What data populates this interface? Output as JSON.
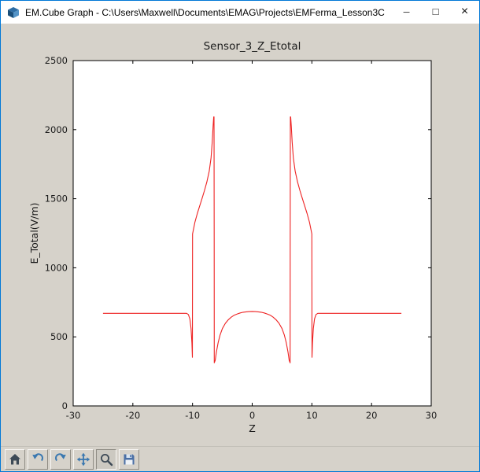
{
  "window": {
    "icon": "emcube-app-icon",
    "title": "EM.Cube Graph - C:\\Users\\Maxwell\\Documents\\EMAG\\Projects\\EMFerma_Lesson3C",
    "controls": {
      "minimize": "─",
      "maximize": "□",
      "close": "×"
    }
  },
  "toolbar": {
    "buttons": [
      {
        "id": "home",
        "icon": "home-icon"
      },
      {
        "id": "back",
        "icon": "back-arrow-icon"
      },
      {
        "id": "forward",
        "icon": "forward-arrow-icon"
      },
      {
        "id": "pan",
        "icon": "pan-arrows-icon"
      },
      {
        "id": "zoom",
        "icon": "zoom-magnifier-icon",
        "active": true
      },
      {
        "id": "save",
        "icon": "save-floppy-icon"
      }
    ]
  },
  "colors": {
    "accent_border": "#0078d7",
    "window_background": "#d6d2ca",
    "plot_background": "#ffffff",
    "axis_color": "#000000",
    "line_color": "#ee2222"
  },
  "chart_data": {
    "type": "line",
    "title": "Sensor_3_Z_Etotal",
    "xlabel": "Z",
    "ylabel": "E_Total(V/m)",
    "xlim": [
      -30,
      30
    ],
    "ylim": [
      0,
      2500
    ],
    "xticks": [
      -30,
      -20,
      -10,
      0,
      10,
      20,
      30
    ],
    "yticks": [
      0,
      500,
      1000,
      1500,
      2000,
      2500
    ],
    "grid": false,
    "line_color": "#ee2222",
    "series": [
      {
        "name": "E_Total",
        "color": "#ee2222",
        "points": [
          [
            -25,
            670
          ],
          [
            -11,
            670
          ],
          [
            -10.7,
            662
          ],
          [
            -10.45,
            630
          ],
          [
            -10.25,
            560
          ],
          [
            -10.1,
            455
          ],
          [
            -10.02,
            352
          ],
          [
            -10,
            1245
          ],
          [
            -9.6,
            1330
          ],
          [
            -9.2,
            1392
          ],
          [
            -8.8,
            1448
          ],
          [
            -8.4,
            1502
          ],
          [
            -8,
            1558
          ],
          [
            -7.6,
            1622
          ],
          [
            -7.2,
            1700
          ],
          [
            -6.9,
            1795
          ],
          [
            -6.7,
            1910
          ],
          [
            -6.55,
            2025
          ],
          [
            -6.45,
            2092
          ],
          [
            -6.4,
            2092
          ],
          [
            -6.37,
            1200
          ],
          [
            -6.35,
            312
          ],
          [
            -6.2,
            330
          ],
          [
            -6,
            390
          ],
          [
            -5.7,
            460
          ],
          [
            -5.4,
            512
          ],
          [
            -5,
            560
          ],
          [
            -4.5,
            598
          ],
          [
            -4,
            624
          ],
          [
            -3.5,
            643
          ],
          [
            -3,
            657
          ],
          [
            -2.5,
            666
          ],
          [
            -2,
            673
          ],
          [
            -1.5,
            678
          ],
          [
            -1,
            681
          ],
          [
            -0.5,
            683
          ],
          [
            0,
            684
          ],
          [
            0.5,
            683
          ],
          [
            1,
            681
          ],
          [
            1.5,
            678
          ],
          [
            2,
            673
          ],
          [
            2.5,
            666
          ],
          [
            3,
            657
          ],
          [
            3.5,
            643
          ],
          [
            4,
            624
          ],
          [
            4.5,
            598
          ],
          [
            5,
            560
          ],
          [
            5.4,
            512
          ],
          [
            5.7,
            460
          ],
          [
            6,
            390
          ],
          [
            6.2,
            330
          ],
          [
            6.35,
            312
          ],
          [
            6.37,
            1200
          ],
          [
            6.4,
            2092
          ],
          [
            6.45,
            2092
          ],
          [
            6.55,
            2025
          ],
          [
            6.7,
            1910
          ],
          [
            6.9,
            1795
          ],
          [
            7.2,
            1700
          ],
          [
            7.6,
            1622
          ],
          [
            8,
            1558
          ],
          [
            8.4,
            1502
          ],
          [
            8.8,
            1448
          ],
          [
            9.2,
            1392
          ],
          [
            9.6,
            1330
          ],
          [
            10,
            1245
          ],
          [
            10.02,
            352
          ],
          [
            10.1,
            455
          ],
          [
            10.25,
            560
          ],
          [
            10.45,
            630
          ],
          [
            10.7,
            662
          ],
          [
            11,
            670
          ],
          [
            25,
            670
          ]
        ]
      }
    ]
  }
}
